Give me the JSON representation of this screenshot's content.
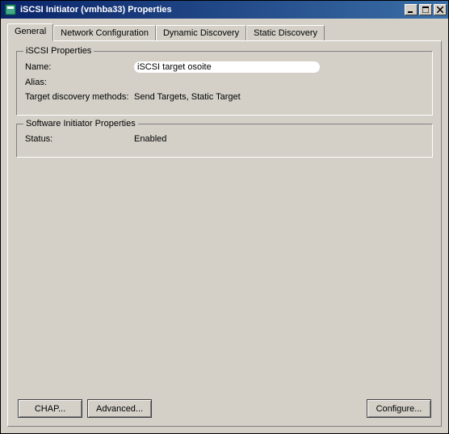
{
  "window": {
    "title": "iSCSI Initiator (vmhba33) Properties"
  },
  "tabs": [
    {
      "label": "General"
    },
    {
      "label": "Network Configuration"
    },
    {
      "label": "Dynamic Discovery"
    },
    {
      "label": "Static Discovery"
    }
  ],
  "iscsi_properties": {
    "legend": "iSCSI Properties",
    "name_label": "Name:",
    "name_value": "iSCSI target osoite",
    "alias_label": "Alias:",
    "alias_value": "",
    "discovery_label": "Target discovery methods:",
    "discovery_value": "Send Targets, Static Target"
  },
  "software_initiator": {
    "legend": "Software Initiator Properties",
    "status_label": "Status:",
    "status_value": "Enabled"
  },
  "buttons": {
    "chap": "CHAP...",
    "advanced": "Advanced...",
    "configure": "Configure..."
  }
}
